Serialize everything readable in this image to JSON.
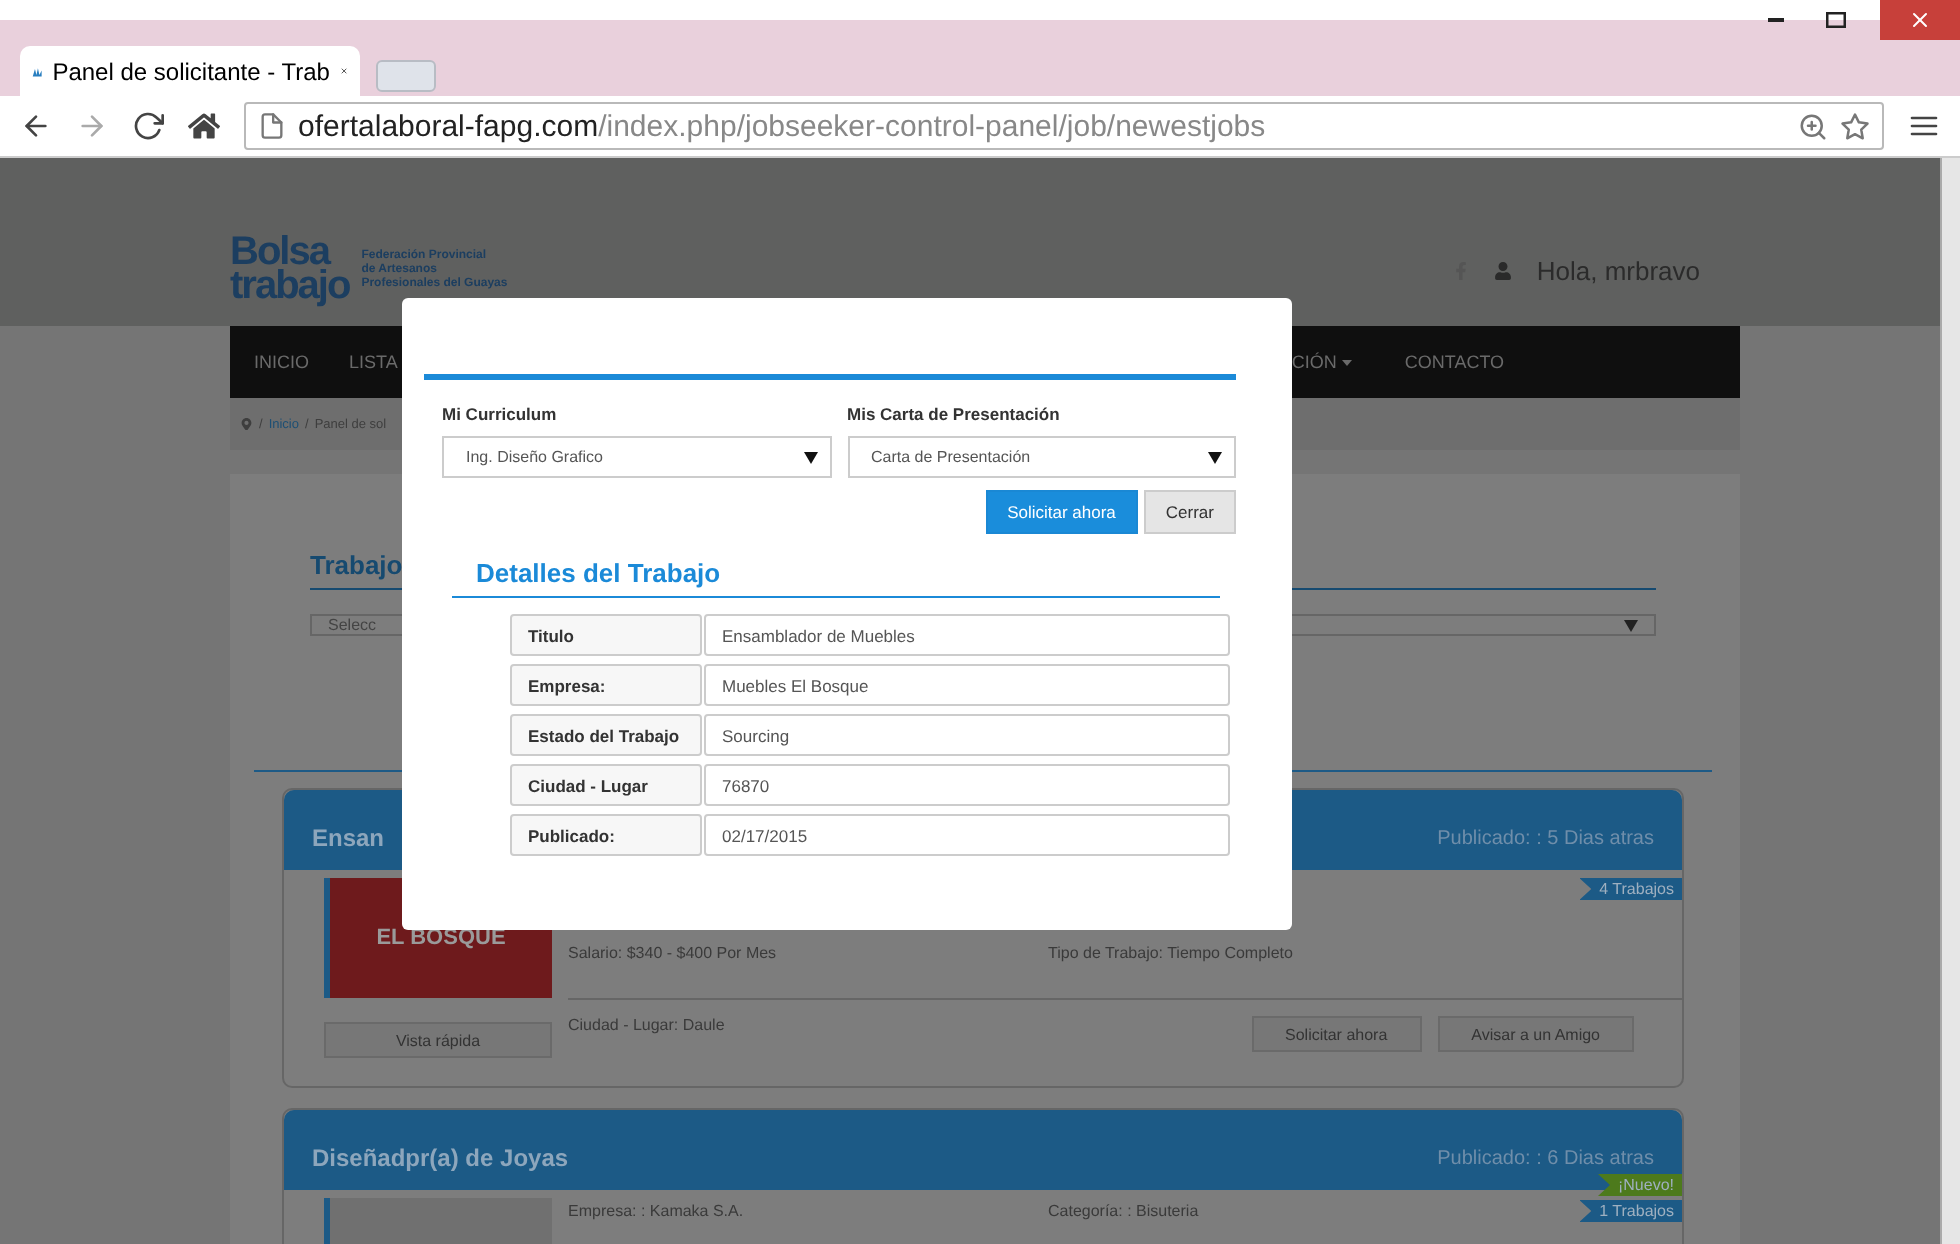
{
  "browser": {
    "tab_title": "Panel de solicitante - Trab",
    "url_host": "ofertalaboral-fapg.com",
    "url_path": "/index.php/jobseeker-control-panel/job/newestjobs"
  },
  "header": {
    "logo_top": "Bolsa",
    "logo_bottom": "trabajo",
    "org_lines": [
      "Federación Provincial",
      "de Artesanos",
      "Profesionales del Guayas"
    ],
    "greeting": "Hola, mrbravo"
  },
  "nav": [
    {
      "label": "INICIO",
      "menu": false
    },
    {
      "label": "LISTA",
      "menu": false
    },
    {
      "label": "CIÓN",
      "menu": true
    },
    {
      "label": "CONTACTO",
      "menu": false
    }
  ],
  "breadcrumb": {
    "separator": "/",
    "items": [
      "Inicio",
      "Panel de sol"
    ]
  },
  "section": {
    "title": "Trabajo",
    "select": "Selecc"
  },
  "cards": [
    {
      "title": "Ensan",
      "posted": "Publicado: : 5 Dias atras",
      "badges": [
        {
          "text": "4 Trabajos",
          "kind": "count"
        }
      ],
      "logo": "EL BOSQUE",
      "left": [
        "Salario: $340 - $400 Por Mes",
        "Ciudad - Lugar:  Daule"
      ],
      "right": "Tipo de Trabajo: Tiempo Completo",
      "quick": "Vista rápida",
      "actions": [
        "Solicitar ahora",
        "Avisar a un Amigo"
      ]
    },
    {
      "title": "Diseñadpr(a) de Joyas",
      "posted": "Publicado: : 6 Dias atras",
      "badges": [
        {
          "text": "¡Nuevo!",
          "kind": "new"
        },
        {
          "text": "1 Trabajos",
          "kind": "count"
        }
      ],
      "left": [
        "Empresa: : Kamaka S.A."
      ],
      "right": "Categoría: : Bisuteria"
    }
  ],
  "modal": {
    "resume_label": "Mi Curriculum",
    "resume_value": "Ing. Diseño Grafico",
    "letter_label": "Mis Carta de Presentación",
    "letter_value": "Carta de Presentación",
    "buttons": [
      {
        "label": "Solicitar ahora",
        "kind": "primary"
      },
      {
        "label": "Cerrar",
        "kind": "default"
      }
    ],
    "details_title": "Detalles del Trabajo",
    "rows": [
      {
        "label": "Titulo",
        "value": "Ensamblador de Muebles"
      },
      {
        "label": "Empresa:",
        "value": "Muebles El Bosque"
      },
      {
        "label": "Estado del Trabajo",
        "value": "Sourcing"
      },
      {
        "label": "Ciudad - Lugar",
        "value": "76870"
      },
      {
        "label": "Publicado:",
        "value": "02/17/2015"
      }
    ]
  }
}
